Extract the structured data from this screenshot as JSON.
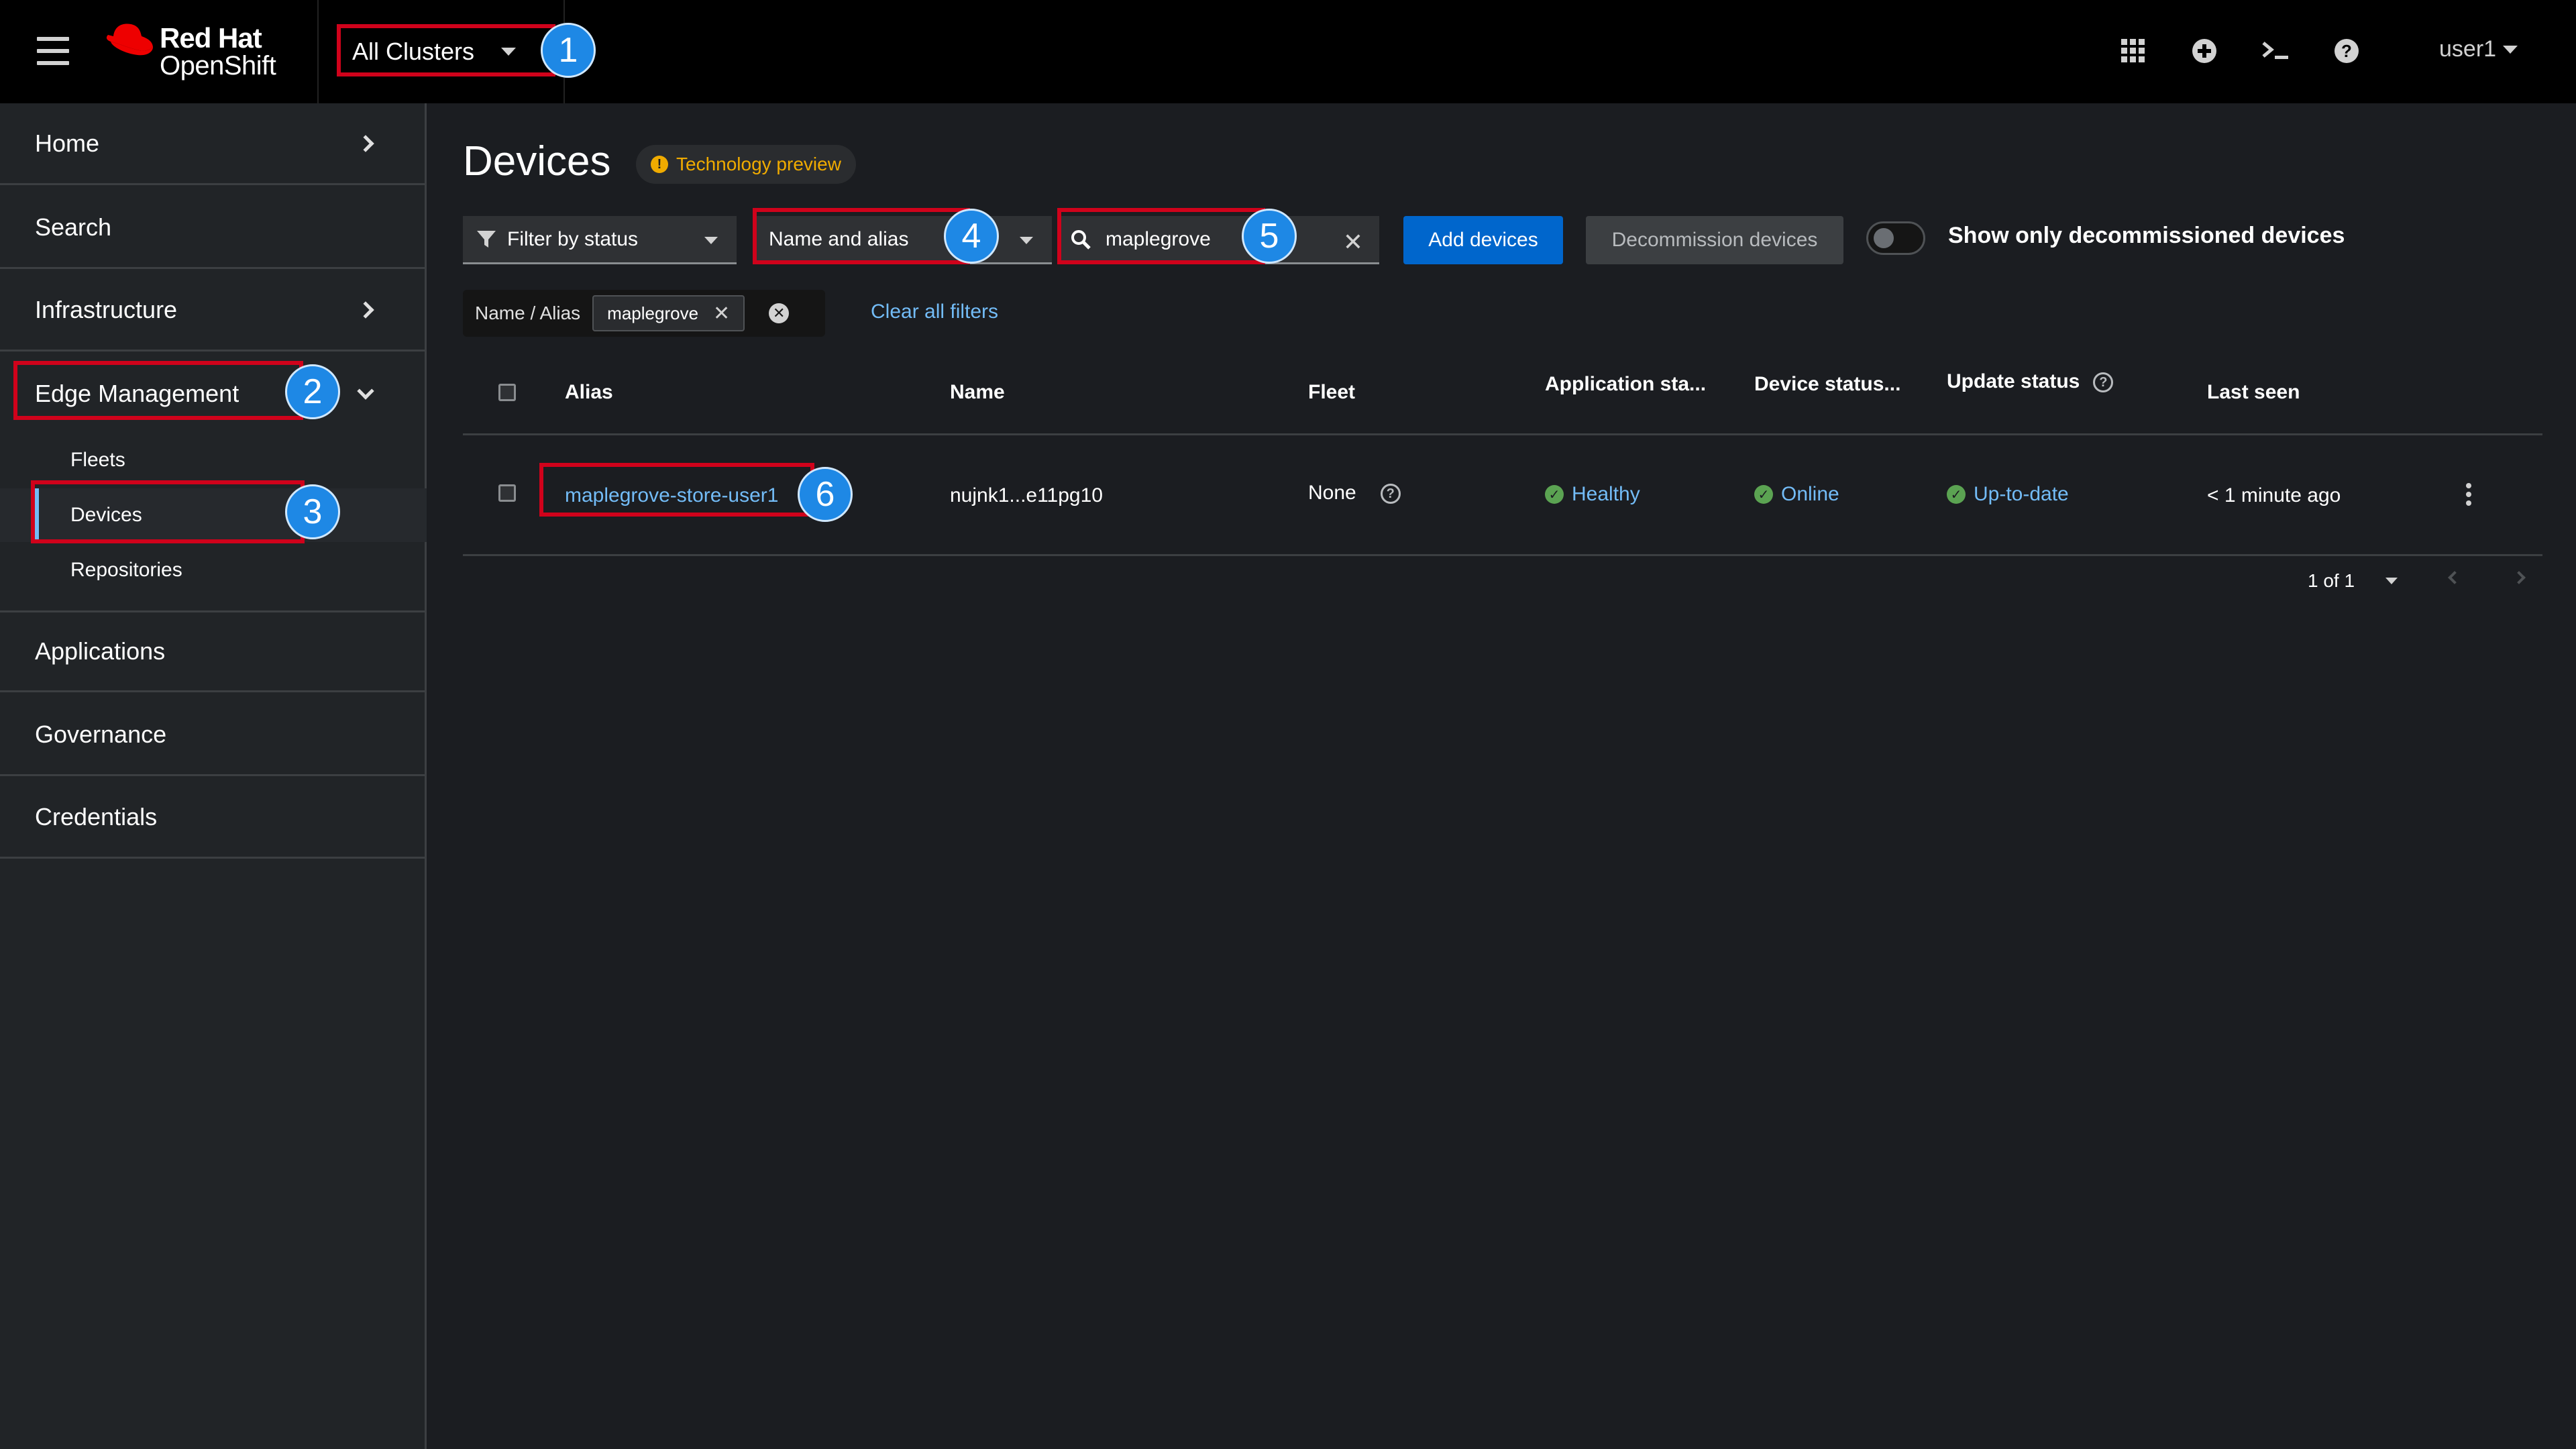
{
  "masthead": {
    "brand_line1": "Red Hat",
    "brand_line2": "OpenShift",
    "cluster_selector": "All Clusters",
    "icons": [
      "grid-icon",
      "plus-circle-icon",
      "terminal-icon",
      "help-icon"
    ],
    "user": "user1"
  },
  "sidebar": {
    "home": "Home",
    "search": "Search",
    "infrastructure": "Infrastructure",
    "edge_management": "Edge Management",
    "fleets": "Fleets",
    "devices": "Devices",
    "repositories": "Repositories",
    "applications": "Applications",
    "governance": "Governance",
    "credentials": "Credentials"
  },
  "main": {
    "title": "Devices",
    "badge": "Technology preview",
    "filter_status": "Filter by status",
    "filter_attribute": "Name and alias",
    "search_value": "maplegrove",
    "add_button": "Add devices",
    "decommission_button": "Decommission devices",
    "toggle_label": "Show only decommissioned devices",
    "chip_category": "Name / Alias",
    "chip_value": "maplegrove",
    "clear_all": "Clear all filters"
  },
  "table": {
    "headers": {
      "alias": "Alias",
      "name": "Name",
      "fleet": "Fleet",
      "app_status": "Application sta...",
      "device_status": "Device status...",
      "update_status": "Update status",
      "last_seen": "Last seen"
    },
    "rows": [
      {
        "alias": "maplegrove-store-user1",
        "name": "nujnk1...e11pg10",
        "fleet": "None",
        "app_status": "Healthy",
        "device_status": "Online",
        "update_status": "Up-to-date",
        "last_seen": "< 1 minute ago"
      }
    ]
  },
  "pagination": {
    "label": "1 of 1"
  },
  "annotations": [
    "1",
    "2",
    "3",
    "4",
    "5",
    "6"
  ],
  "colors": {
    "accent": "#0066cc",
    "link": "#73bcf7",
    "highlight": "#d0021b",
    "marker": "#1e88e5",
    "success": "#5ba352",
    "warning": "#f0ab00"
  }
}
